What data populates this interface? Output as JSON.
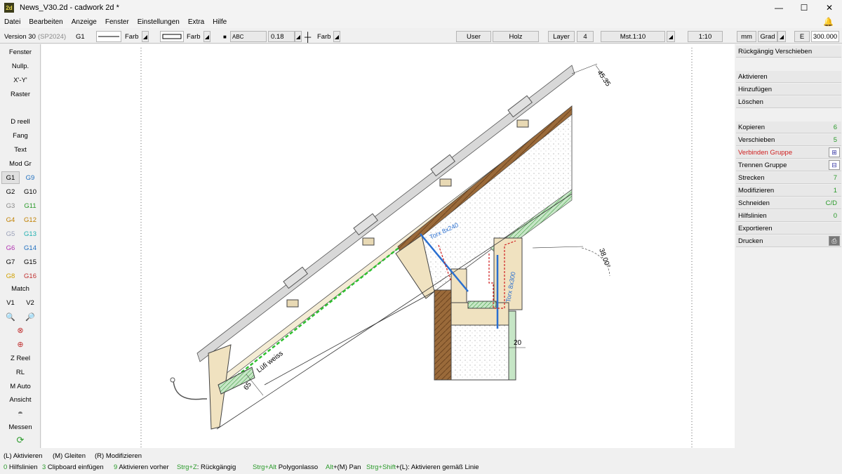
{
  "window": {
    "title": "News_V30.2d - cadwork 2d  *",
    "app_icon": "2d",
    "minimize": "—",
    "maximize": "☐",
    "close": "✕"
  },
  "menu": [
    "Datei",
    "Bearbeiten",
    "Anzeige",
    "Fenster",
    "Einstellungen",
    "Extra",
    "Hilfe"
  ],
  "toolbar": {
    "version": "Version 30",
    "sp": "(SP2024)",
    "group": "G1",
    "farb1": "Farb",
    "farb2": "Farb",
    "font_preview": "ABC",
    "line_width": "0.18",
    "farb3": "Farb",
    "user": "User",
    "holz": "Holz",
    "layer_label": "Layer",
    "layer_value": "4",
    "mst": "Mst.1:10",
    "scale": "1:10",
    "unit": "mm",
    "angle_unit": "Grad",
    "e_label": "E",
    "e_value": "300.000"
  },
  "left_panel": {
    "buttons": [
      "Fenster",
      "Nullp.",
      "X'-Y'",
      "Raster",
      "D reell",
      "Fang",
      "Text",
      "Mod Gr"
    ],
    "groups": [
      {
        "l": "G1",
        "r": "G9",
        "lc": "#000000",
        "rc": "#1f6fbf"
      },
      {
        "l": "G2",
        "r": "G10",
        "lc": "#000000",
        "rc": "#000000"
      },
      {
        "l": "G3",
        "r": "G11",
        "lc": "#8a8a8a",
        "rc": "#2a9a2a"
      },
      {
        "l": "G4",
        "r": "G12",
        "lc": "#c08000",
        "rc": "#c08000"
      },
      {
        "l": "G5",
        "r": "G13",
        "lc": "#9aa0b8",
        "rc": "#20b0b0"
      },
      {
        "l": "G6",
        "r": "G14",
        "lc": "#b030b0",
        "rc": "#1f6fbf"
      },
      {
        "l": "G7",
        "r": "G15",
        "lc": "#000000",
        "rc": "#000000"
      },
      {
        "l": "G8",
        "r": "G16",
        "lc": "#d0a000",
        "rc": "#c03030"
      }
    ],
    "match": "Match",
    "v1": "V1",
    "v2": "V2",
    "bottom": [
      "Z Reel",
      "RL",
      "M Auto",
      "Ansicht",
      "Messen"
    ]
  },
  "right_panel": {
    "undo": "Rückgängig Verschieben",
    "items": [
      {
        "label": "Aktivieren",
        "num": ""
      },
      {
        "label": "Hinzufügen",
        "num": ""
      },
      {
        "label": "Löschen",
        "num": ""
      },
      {
        "label": "Kopieren",
        "num": "6"
      },
      {
        "label": "Verschieben",
        "num": "5"
      },
      {
        "label": "Verbinden Gruppe",
        "num": ""
      },
      {
        "label": "Trennen Gruppe",
        "num": ""
      },
      {
        "label": "Strecken",
        "num": "7"
      },
      {
        "label": "Modifizieren",
        "num": "1"
      },
      {
        "label": "Schneiden",
        "num": "C/D"
      },
      {
        "label": "Hilfslinien",
        "num": "0"
      },
      {
        "label": "Exportieren",
        "num": ""
      },
      {
        "label": "Drucken",
        "num": ""
      }
    ],
    "highlight_color": "#d02020"
  },
  "drawing": {
    "dim_top": "45.35",
    "dim_angle": "38.00°",
    "torx1": "Torx 8x240",
    "torx2": "Torx 8x300",
    "dim_20": "20",
    "dim_65": "65",
    "lueftung": "Lüfi weiss"
  },
  "status": {
    "line1": [
      "(L) Aktivieren",
      "(M) Gleiten",
      "(R) Modifizieren"
    ],
    "line2": [
      {
        "k": "0",
        "t": " Hilfslinien"
      },
      {
        "k": "3",
        "t": " Clipboard einfügen"
      },
      {
        "k": "9",
        "t": " Aktivieren vorher"
      },
      {
        "k": "Strg+Z",
        "t": ": Rückgängig"
      },
      {
        "k": "Strg+Alt",
        "t": " Polygonlasso"
      },
      {
        "k": "Alt",
        "t": "+(M) Pan"
      },
      {
        "k": "Strg+Shift",
        "t": "+(L): Aktivieren gemäß Linie"
      }
    ]
  }
}
